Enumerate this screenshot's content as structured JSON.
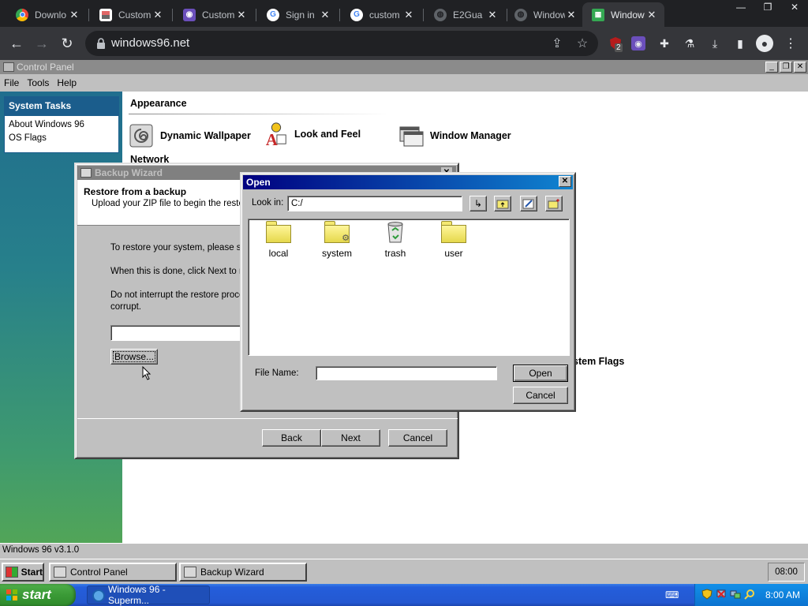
{
  "browser": {
    "tabs": [
      {
        "title": "Downlo",
        "favicon": "chrome-icon",
        "color": "#f1c232"
      },
      {
        "title": "Custom",
        "favicon": "generic-site-icon",
        "color": "#e06666"
      },
      {
        "title": "Custom",
        "favicon": "tampermonkey-icon",
        "color": "#6b4fbb"
      },
      {
        "title": "Sign in",
        "favicon": "google-icon",
        "color": "#4285f4"
      },
      {
        "title": "custom",
        "favicon": "google-icon",
        "color": "#4285f4"
      },
      {
        "title": "E2Gua",
        "favicon": "globe-icon",
        "color": "#9aa0a6"
      },
      {
        "title": "Window",
        "favicon": "globe-icon",
        "color": "#9aa0a6"
      },
      {
        "title": "Window",
        "favicon": "windows96-icon",
        "color": "#35a853"
      }
    ],
    "url": "windows96.net",
    "extension_badge": "2"
  },
  "control_panel": {
    "title": "Control Panel",
    "menu": [
      "File",
      "Tools",
      "Help"
    ],
    "system_tasks": {
      "title": "System Tasks",
      "items": [
        "About Windows 96",
        "OS Flags"
      ]
    },
    "section": "Appearance",
    "applets": [
      "Dynamic Wallpaper",
      "Look and Feel",
      "Window Manager"
    ],
    "network_label": "Network",
    "system_flags_label": "stem Flags",
    "status": "Windows 96 v3.1.0"
  },
  "backup_wizard": {
    "title": "Backup Wizard",
    "heading": "Restore from a backup",
    "subheading": "Upload your ZIP file to begin the restore p",
    "line1": "To restore your system, please selec",
    "line2": "When this is done, click Next to rest",
    "line3a": "Do not interrupt the restore process,",
    "line3b": "corrupt.",
    "browse": "Browse...",
    "back": "Back",
    "next": "Next",
    "cancel": "Cancel",
    "file_value": ""
  },
  "open_dialog": {
    "title": "Open",
    "look_in_label": "Look in:",
    "look_in_value": "C:/",
    "files": [
      {
        "name": "local",
        "icon": "folder-icon"
      },
      {
        "name": "system",
        "icon": "system-folder-icon"
      },
      {
        "name": "trash",
        "icon": "recycle-bin-icon"
      },
      {
        "name": "user",
        "icon": "folder-icon"
      }
    ],
    "file_name_label": "File Name:",
    "file_name_value": "",
    "open": "Open",
    "cancel": "Cancel"
  },
  "w96_taskbar": {
    "start": "Start",
    "tasks": [
      "Control Panel",
      "Backup Wizard"
    ],
    "clock": "08:00"
  },
  "xp_taskbar": {
    "start": "start",
    "task": "Windows 96 - Superm...",
    "clock": "8:00 AM"
  }
}
